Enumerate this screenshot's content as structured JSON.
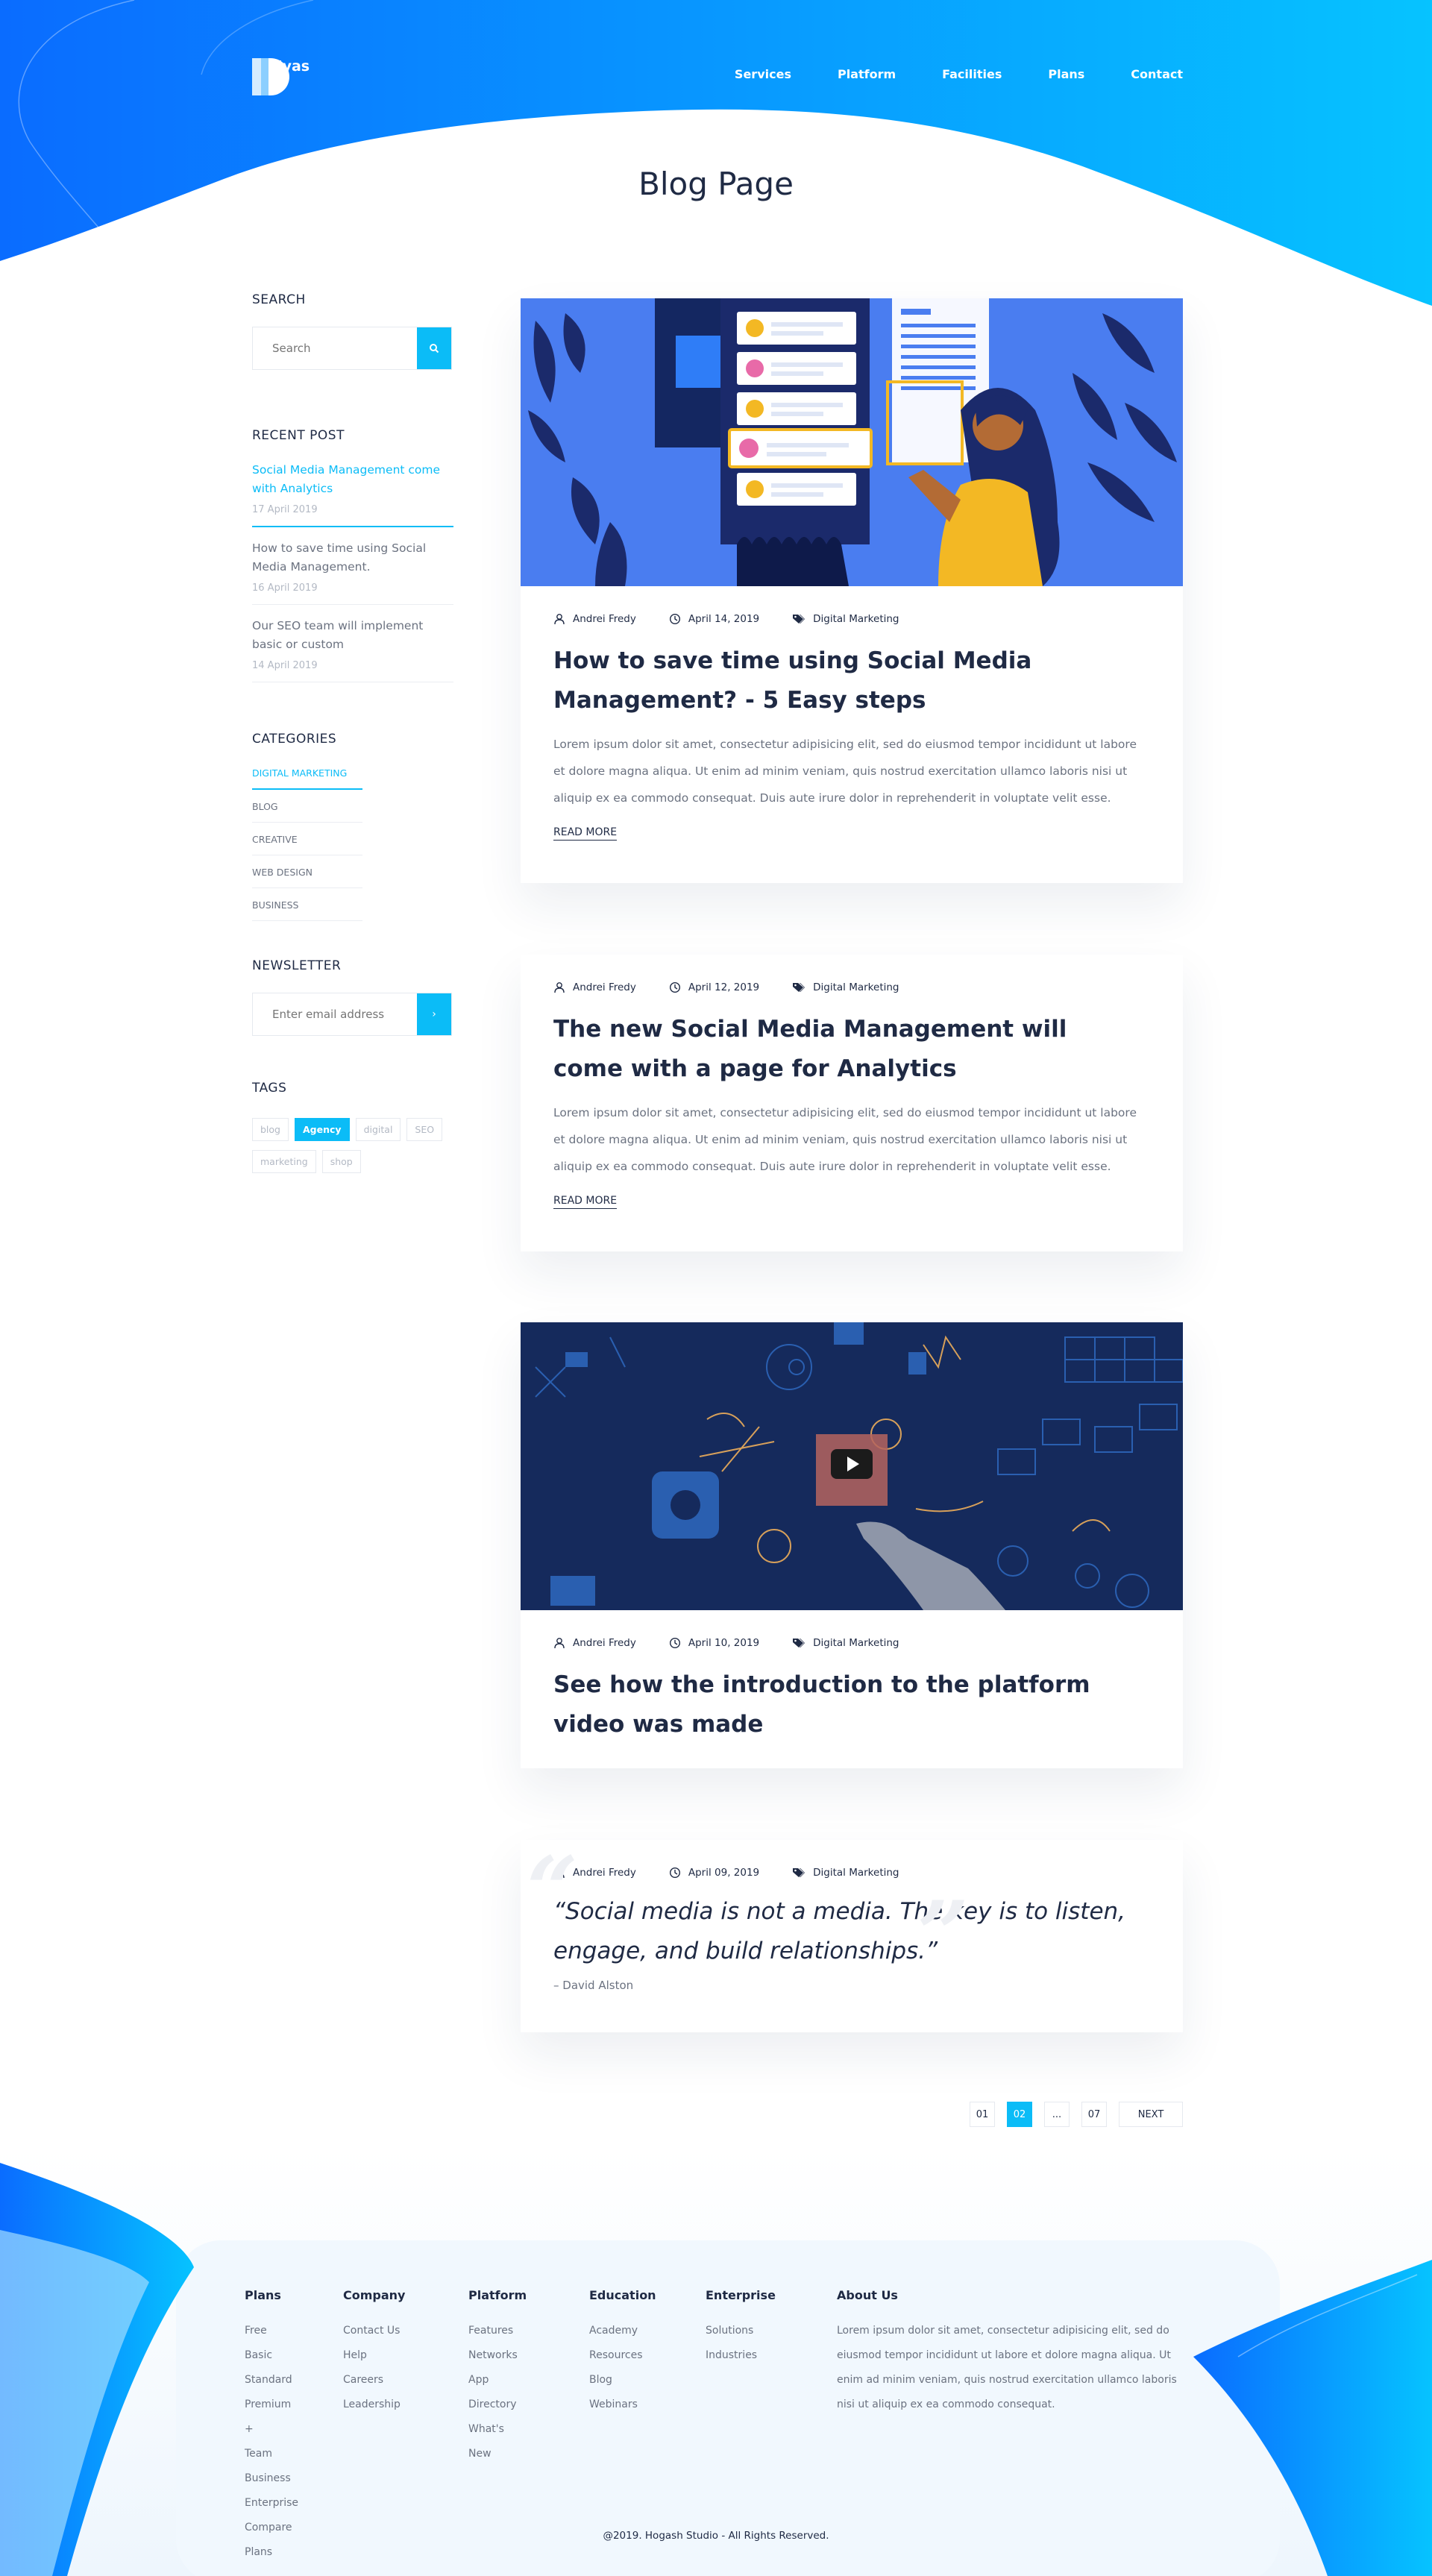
{
  "brand": {
    "name": "Kallyas"
  },
  "nav": [
    "Services",
    "Platform",
    "Facilities",
    "Plans",
    "Contact"
  ],
  "page_title": "Blog Page",
  "colors": {
    "accent": "#0bbcf7",
    "brand_blue": "#0a6cff",
    "text_dark": "#1f2a44",
    "text_muted": "#6b7280"
  },
  "sidebar": {
    "search": {
      "heading": "SEARCH",
      "placeholder": "Search"
    },
    "recent": {
      "heading": "RECENT POST",
      "items": [
        {
          "title": "Social Media Management come with Analytics",
          "date": "17 April 2019"
        },
        {
          "title": "How to save time using Social Media Management.",
          "date": "16 April 2019"
        },
        {
          "title": "Our SEO team will implement basic or custom",
          "date": "14 April 2019"
        }
      ]
    },
    "categories": {
      "heading": "CATEGORIES",
      "items": [
        "DIGITAL MARKETING",
        "BLOG",
        "CREATIVE",
        "WEB DESIGN",
        "BUSINESS"
      ]
    },
    "newsletter": {
      "heading": "NEWSLETTER",
      "placeholder": "Enter email address",
      "submit_icon": "chevron-right-icon"
    },
    "tags": {
      "heading": "TAGS",
      "items": [
        "blog",
        "Agency",
        "digital",
        "SEO",
        "marketing",
        "shop"
      ]
    }
  },
  "posts": [
    {
      "author": "Andrei Fredy",
      "date": "April 14, 2019",
      "category": "Digital Marketing",
      "title_line1": "How to save time using Social Media",
      "title_line2": "Management? - 5 Easy steps",
      "excerpt": "Lorem ipsum dolor sit amet, consectetur adipisicing elit, sed do eiusmod tempor incididunt ut labore et dolore magna aliqua. Ut enim ad minim veniam, quis nostrud exercitation ullamco laboris nisi ut aliquip ex ea commodo consequat. Duis aute irure dolor in reprehenderit in voluptate velit esse.",
      "read_more": "READ MORE"
    },
    {
      "author": "Andrei Fredy",
      "date": "April 12, 2019",
      "category": "Digital Marketing",
      "title_line1": "The new Social Media Management will",
      "title_line2": "come with a page for Analytics",
      "excerpt": "Lorem ipsum dolor sit amet, consectetur adipisicing elit, sed do eiusmod tempor incididunt ut labore et dolore magna aliqua. Ut enim ad minim veniam, quis nostrud exercitation ullamco laboris nisi ut aliquip ex ea commodo consequat. Duis aute irure dolor in reprehenderit in voluptate velit esse.",
      "read_more": "READ MORE"
    },
    {
      "author": "Andrei Fredy",
      "date": "April 10, 2019",
      "category": "Digital Marketing",
      "title_line1": "See how the introduction to the platform",
      "title_line2": "video was made"
    },
    {
      "author": "Andrei Fredy",
      "date": "April 09, 2019",
      "category": "Digital Marketing",
      "quote_line1": "“Social media is not a media. The key is to listen,",
      "quote_line2": "engage, and build relationships.”",
      "quote_author": "– David Alston"
    }
  ],
  "pagination": [
    "01",
    "02",
    "...",
    "07",
    "NEXT"
  ],
  "footer": {
    "columns": [
      {
        "heading": "Plans",
        "links": [
          "Free",
          "Basic",
          "Standard",
          "Premium +",
          "Team",
          "Business",
          "Enterprise",
          "Compare Plans"
        ]
      },
      {
        "heading": "Company",
        "links": [
          "Contact Us",
          "Help",
          "Careers",
          "Leadership"
        ]
      },
      {
        "heading": "Platform",
        "links": [
          "Features",
          "Networks",
          "App Directory",
          "What's New"
        ]
      },
      {
        "heading": "Education",
        "links": [
          "Academy",
          "Resources",
          "Blog",
          "Webinars"
        ]
      },
      {
        "heading": "Enterprise",
        "links": [
          "Solutions",
          "Industries"
        ]
      }
    ],
    "about": {
      "heading": "About Us",
      "text": "Lorem ipsum dolor sit amet, consectetur adipisicing elit, sed do eiusmod tempor incididunt ut labore et dolore magna aliqua. Ut enim ad minim veniam, quis nostrud exercitation ullamco laboris nisi ut aliquip ex ea commodo consequat."
    },
    "copyright": "@2019. Hogash Studio - All Rights Reserved."
  }
}
